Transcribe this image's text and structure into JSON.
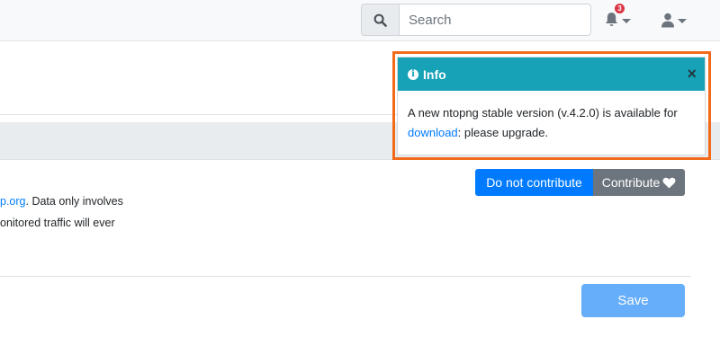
{
  "navbar": {
    "search": {
      "placeholder": "Search"
    },
    "notifications": {
      "count": "3"
    }
  },
  "page": {
    "text_line1_link": "p.org",
    "text_line1_rest": ". Data only involves",
    "text_line2": "onitored traffic will ever",
    "do_not_contribute": "Do not contribute",
    "contribute": "Contribute",
    "save": "Save"
  },
  "toast": {
    "title": "Info",
    "close": "×",
    "message_part1": "A new ntopng stable version (v.4.2.0) is available for",
    "link": "download",
    "message_part2": ": please upgrade."
  },
  "colors": {
    "toast_header": "#17a2b8",
    "highlight": "#f26b1d",
    "primary": "#007bff",
    "secondary": "#6c757d"
  },
  "icons": [
    "search-icon",
    "bell-icon",
    "user-icon",
    "info-icon",
    "close-icon",
    "heart-icon"
  ]
}
